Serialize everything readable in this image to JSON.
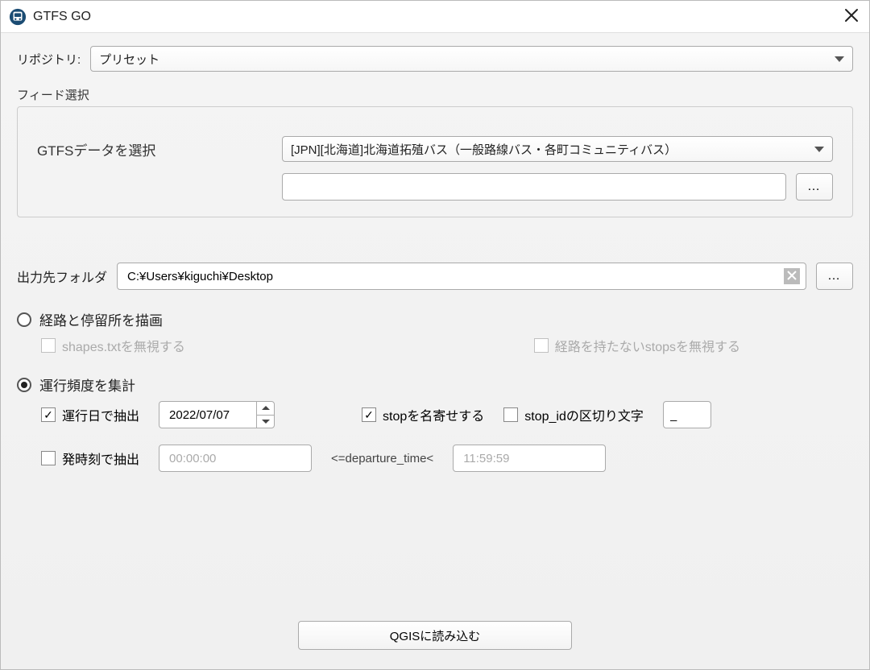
{
  "title": "GTFS GO",
  "repository": {
    "label": "リポジトリ:",
    "selected": "プリセット"
  },
  "feed": {
    "group_label": "フィード選択",
    "select_label": "GTFSデータを選択",
    "selected": "[JPN][北海道]北海道拓殖バス（一般路線バス・各町コミュニティバス）",
    "path_value": "",
    "browse": "…"
  },
  "output": {
    "label": "出力先フォルダ",
    "value": "C:¥Users¥kiguchi¥Desktop",
    "browse": "…"
  },
  "mode": {
    "draw_routes_stops": {
      "label": "経路と停留所を描画",
      "checked": false,
      "ignore_shapes": {
        "label": "shapes.txtを無視する",
        "checked": false
      },
      "ignore_stops": {
        "label": "経路を持たないstopsを無視する",
        "checked": false
      }
    },
    "aggregate_freq": {
      "label": "運行頻度を集計",
      "checked": true
    }
  },
  "freq": {
    "by_date": {
      "label": "運行日で抽出",
      "checked": true,
      "date": "2022/07/07"
    },
    "merge_stops": {
      "label": "stopを名寄せする",
      "checked": true
    },
    "stopid_sep": {
      "label": "stop_idの区切り文字",
      "checked": false,
      "value": "_"
    },
    "by_time": {
      "label": "発時刻で抽出",
      "checked": false,
      "start": "00:00:00",
      "op": "<=departure_time<",
      "end": "11:59:59"
    }
  },
  "footer": {
    "load": "QGISに読み込む"
  }
}
